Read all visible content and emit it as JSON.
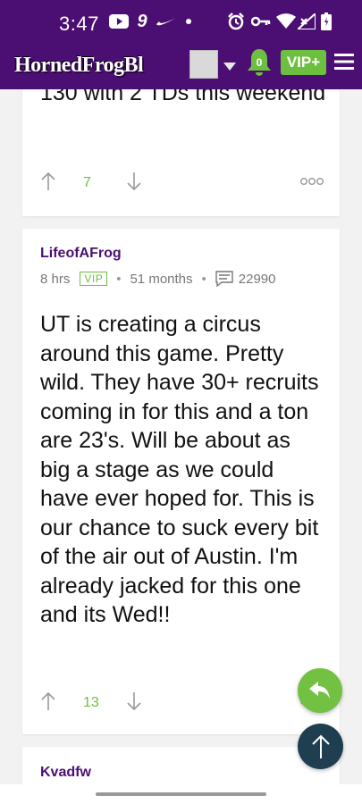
{
  "status_bar": {
    "time": "3:47",
    "icons": [
      "youtube-icon",
      "nine-app-icon",
      "nike-icon",
      "dot-icon",
      "alarm-icon",
      "key-icon",
      "wifi-icon",
      "signal-icon",
      "battery-icon"
    ]
  },
  "header": {
    "logo_text": "HornedFrogBl",
    "notification_count": "0",
    "vip_button_label": "VIP+",
    "colors": {
      "brand_purple": "#4b0f73",
      "accent_green": "#6dbf3f"
    }
  },
  "posts": [
    {
      "body": "130 with 2 TDs this weekend",
      "score": "7"
    },
    {
      "author": "LifeofAFrog",
      "time_ago": "8 hrs",
      "badge": "VIP",
      "tenure": "51 months",
      "post_count": "22990",
      "body": "UT is creating a circus around this game. Pretty wild. They have 30+ recruits coming in for this and a ton are 23's. Will be about as big a stage as we could have ever hoped for. This is our chance to suck every bit of the air out of Austin. I'm already jacked for this one and its Wed!!",
      "score": "13"
    },
    {
      "author": "Kvadfw"
    }
  ]
}
